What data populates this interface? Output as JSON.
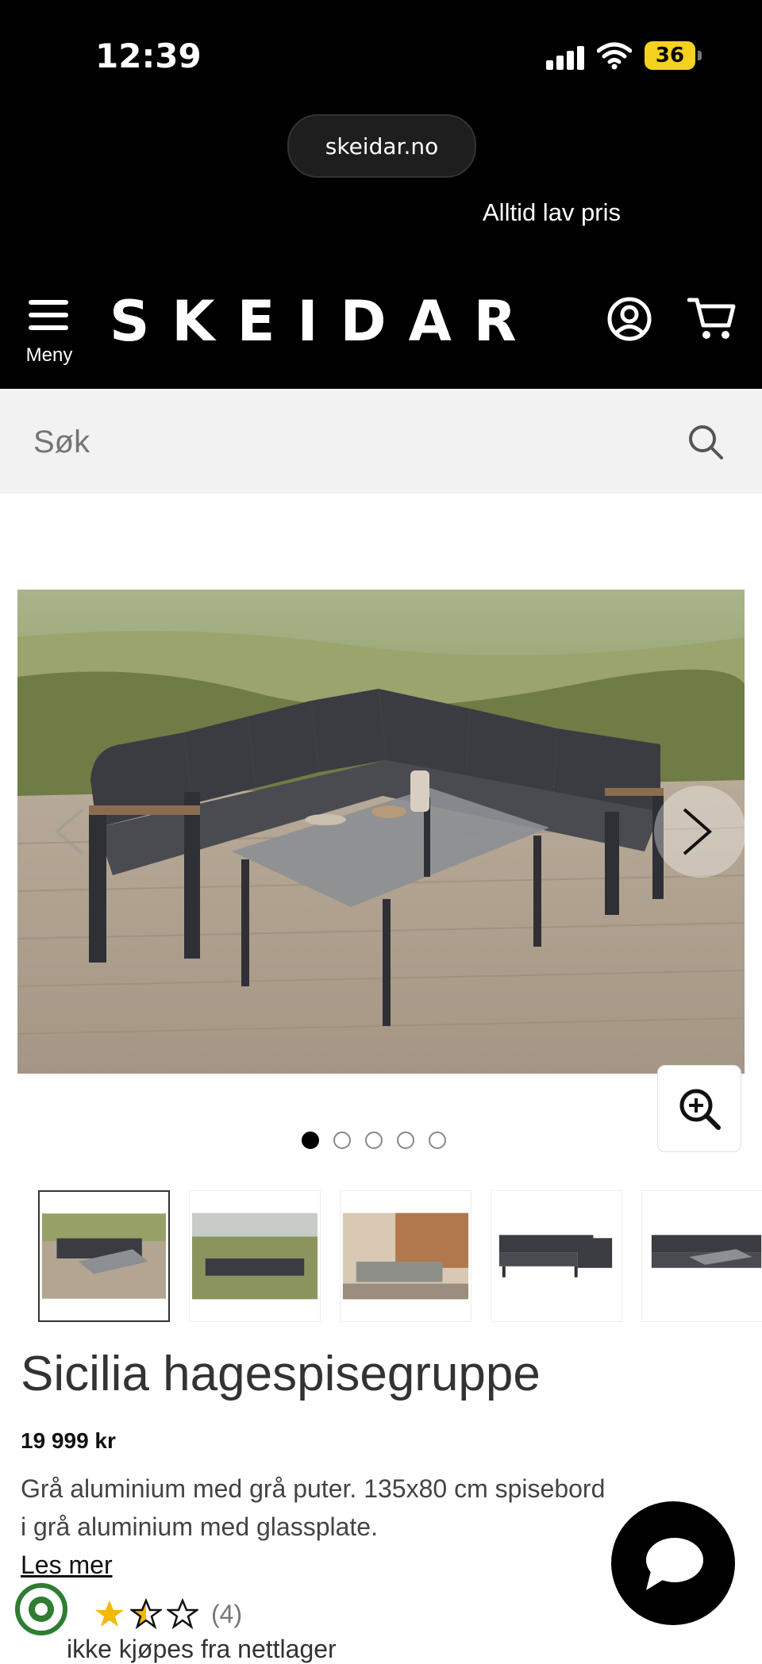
{
  "status_bar": {
    "time": "12:39",
    "battery": "36",
    "icons": [
      "signal-icon",
      "wifi-icon",
      "battery-icon"
    ],
    "battery_color": "#f4d21f"
  },
  "browser": {
    "url": "skeidar.no"
  },
  "header": {
    "tagline": "Alltid lav pris",
    "menu_label": "Meny",
    "logo": "SKEIDAR",
    "icons": [
      "menu-icon",
      "account-icon",
      "cart-icon"
    ]
  },
  "search": {
    "placeholder": "Søk",
    "icon": "search-icon"
  },
  "gallery": {
    "dots": [
      true,
      false,
      false,
      false,
      false
    ],
    "thumbnails": [
      "thumb-1",
      "thumb-2",
      "thumb-3",
      "thumb-4",
      "thumb-5"
    ],
    "icons": [
      "chevron-left-icon",
      "chevron-right-icon",
      "zoom-in-icon"
    ]
  },
  "product": {
    "title": "Sicilia hagespisegruppe",
    "price": "19 999 kr",
    "description_line1": "Grå aluminium med grå puter. 135x80 cm spisebord",
    "description_line2": "i grå aluminium med glassplate.",
    "read_more": "Les mer",
    "rating": 2.5,
    "rating_count": "(4)",
    "cutoff_text": "ikke kjøpes fra nettlager"
  },
  "colors": {
    "header_bg": "#000000",
    "search_bg": "#f2f2f2",
    "star": "#f5b800",
    "eco_green": "#2e7d32"
  },
  "chat": {
    "icon": "chat-icon"
  }
}
